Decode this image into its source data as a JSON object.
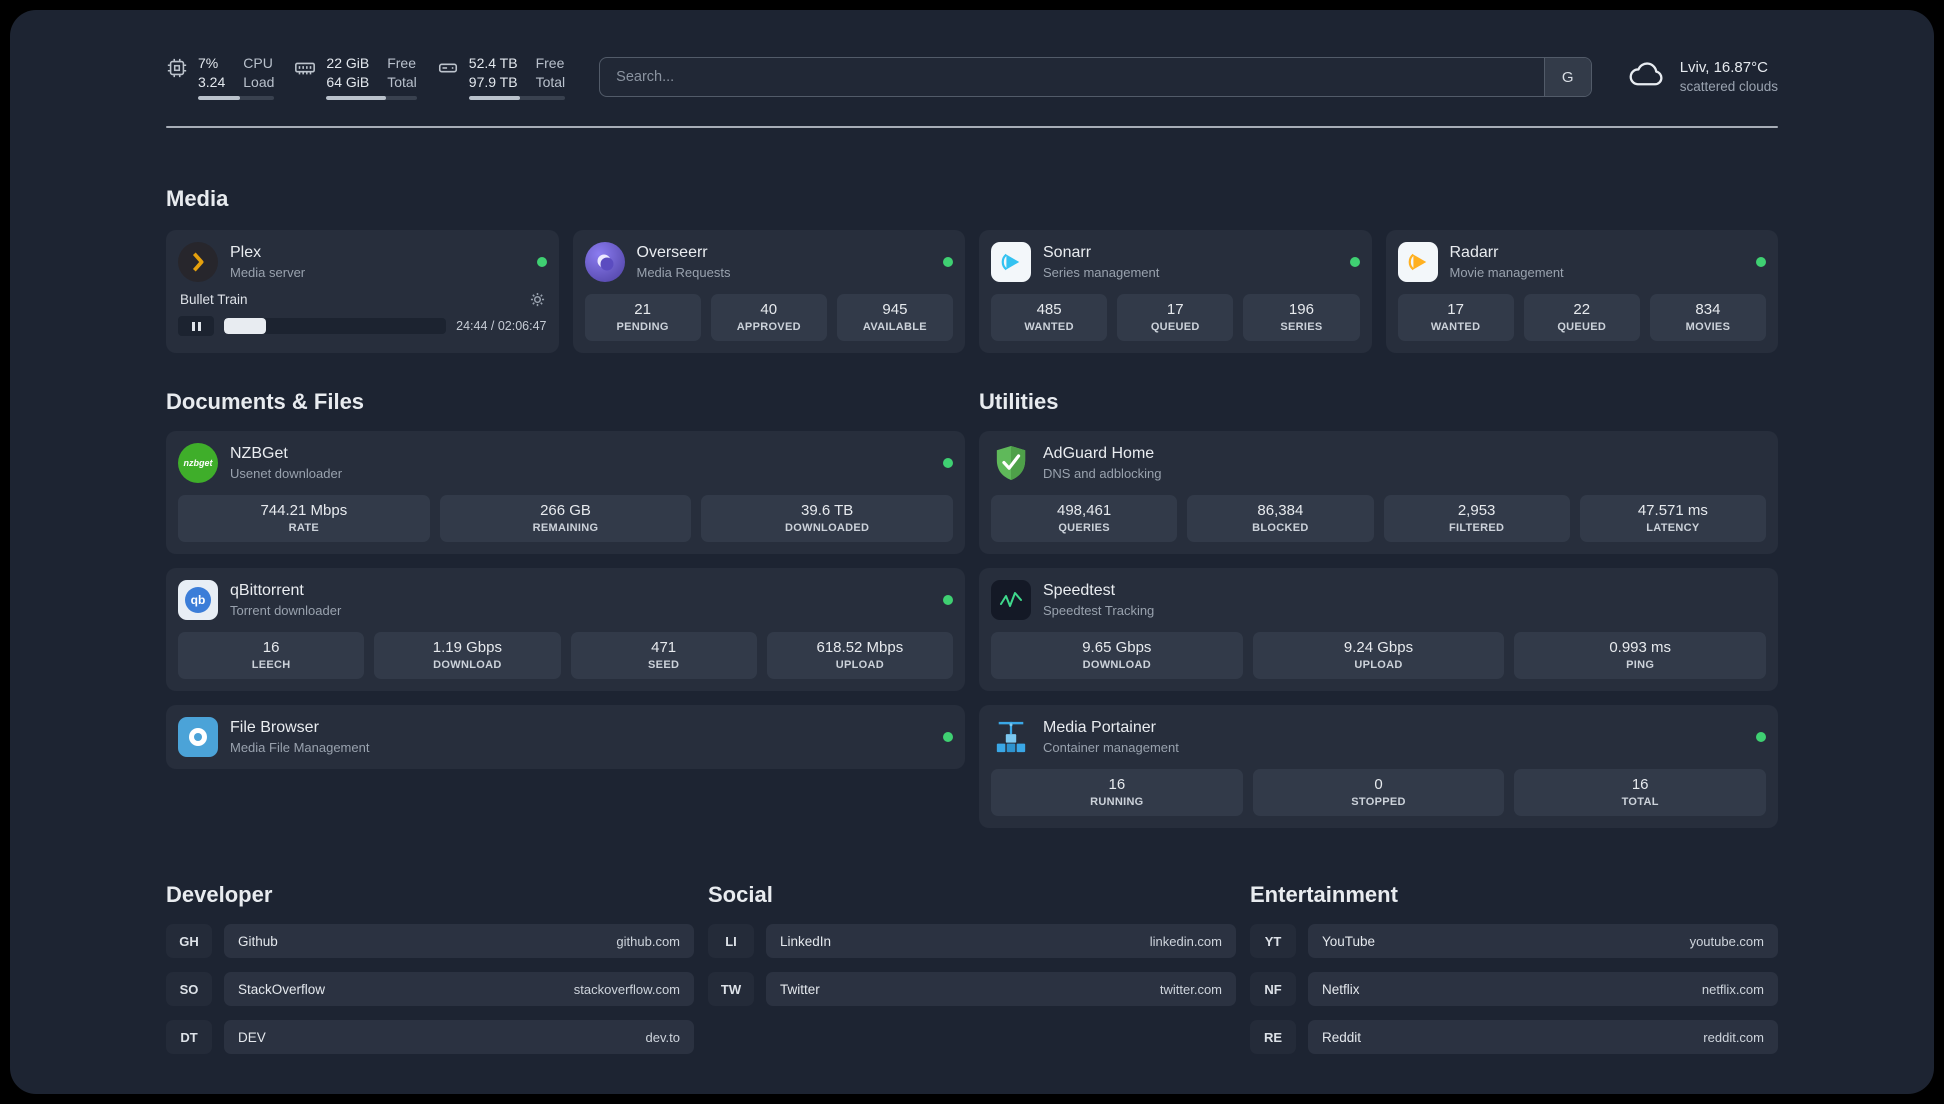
{
  "colors": {
    "background": "#1d2432",
    "card": "#272e3c",
    "stat_box": "#323a49",
    "status_dot_green": "#3fd072",
    "plex_gold": "#e5a00d",
    "sonarr_blue": "#33c2f1",
    "radarr_amber": "#ffb020",
    "speedtest_green": "#3fd98c"
  },
  "topbar": {
    "cpu": {
      "value1": "7%",
      "value2": "3.24",
      "label1": "CPU",
      "label2": "Load",
      "bar_percent": 55
    },
    "ram": {
      "value1": "22 GiB",
      "value2": "64 GiB",
      "label1": "Free",
      "label2": "Total",
      "bar_percent": 66
    },
    "disk": {
      "value1": "52.4 TB",
      "value2": "97.9 TB",
      "label1": "Free",
      "label2": "Total",
      "bar_percent": 53
    },
    "search": {
      "placeholder": "Search...",
      "button": "G"
    },
    "weather": {
      "location": "Lviv, 16.87°C",
      "condition": "scattered clouds"
    }
  },
  "media": {
    "title": "Media",
    "cards": [
      {
        "name": "Plex",
        "desc": "Media server",
        "player": {
          "track": "Bullet Train",
          "time": "24:44 / 02:06:47",
          "progress_percent": 19
        }
      },
      {
        "name": "Overseerr",
        "desc": "Media Requests",
        "stats": [
          {
            "value": "21",
            "label": "PENDING"
          },
          {
            "value": "40",
            "label": "APPROVED"
          },
          {
            "value": "945",
            "label": "AVAILABLE"
          }
        ]
      },
      {
        "name": "Sonarr",
        "desc": "Series management",
        "stats": [
          {
            "value": "485",
            "label": "WANTED"
          },
          {
            "value": "17",
            "label": "QUEUED"
          },
          {
            "value": "196",
            "label": "SERIES"
          }
        ]
      },
      {
        "name": "Radarr",
        "desc": "Movie management",
        "stats": [
          {
            "value": "17",
            "label": "WANTED"
          },
          {
            "value": "22",
            "label": "QUEUED"
          },
          {
            "value": "834",
            "label": "MOVIES"
          }
        ]
      }
    ]
  },
  "documents": {
    "title": "Documents & Files",
    "cards": [
      {
        "name": "NZBGet",
        "desc": "Usenet downloader",
        "stats": [
          {
            "value": "744.21 Mbps",
            "label": "RATE"
          },
          {
            "value": "266 GB",
            "label": "REMAINING"
          },
          {
            "value": "39.6 TB",
            "label": "DOWNLOADED"
          }
        ]
      },
      {
        "name": "qBittorrent",
        "desc": "Torrent downloader",
        "stats": [
          {
            "value": "16",
            "label": "LEECH"
          },
          {
            "value": "1.19 Gbps",
            "label": "DOWNLOAD"
          },
          {
            "value": "471",
            "label": "SEED"
          },
          {
            "value": "618.52 Mbps",
            "label": "UPLOAD"
          }
        ]
      },
      {
        "name": "File Browser",
        "desc": "Media File Management"
      }
    ]
  },
  "utilities": {
    "title": "Utilities",
    "cards": [
      {
        "name": "AdGuard Home",
        "desc": "DNS and adblocking",
        "stats": [
          {
            "value": "498,461",
            "label": "QUERIES"
          },
          {
            "value": "86,384",
            "label": "BLOCKED"
          },
          {
            "value": "2,953",
            "label": "FILTERED"
          },
          {
            "value": "47.571 ms",
            "label": "LATENCY"
          }
        ]
      },
      {
        "name": "Speedtest",
        "desc": "Speedtest Tracking",
        "stats": [
          {
            "value": "9.65 Gbps",
            "label": "DOWNLOAD"
          },
          {
            "value": "9.24 Gbps",
            "label": "UPLOAD"
          },
          {
            "value": "0.993 ms",
            "label": "PING"
          }
        ]
      },
      {
        "name": "Media Portainer",
        "desc": "Container management",
        "stats": [
          {
            "value": "16",
            "label": "RUNNING"
          },
          {
            "value": "0",
            "label": "STOPPED"
          },
          {
            "value": "16",
            "label": "TOTAL"
          }
        ]
      }
    ]
  },
  "links": {
    "developer": {
      "title": "Developer",
      "items": [
        {
          "abbr": "GH",
          "name": "Github",
          "url": "github.com"
        },
        {
          "abbr": "SO",
          "name": "StackOverflow",
          "url": "stackoverflow.com"
        },
        {
          "abbr": "DT",
          "name": "DEV",
          "url": "dev.to"
        }
      ]
    },
    "social": {
      "title": "Social",
      "items": [
        {
          "abbr": "LI",
          "name": "LinkedIn",
          "url": "linkedin.com"
        },
        {
          "abbr": "TW",
          "name": "Twitter",
          "url": "twitter.com"
        }
      ]
    },
    "entertainment": {
      "title": "Entertainment",
      "items": [
        {
          "abbr": "YT",
          "name": "YouTube",
          "url": "youtube.com"
        },
        {
          "abbr": "NF",
          "name": "Netflix",
          "url": "netflix.com"
        },
        {
          "abbr": "RE",
          "name": "Reddit",
          "url": "reddit.com"
        }
      ]
    }
  },
  "icon_text": {
    "nzbget": "nzbget",
    "qbittorrent": "qb"
  }
}
